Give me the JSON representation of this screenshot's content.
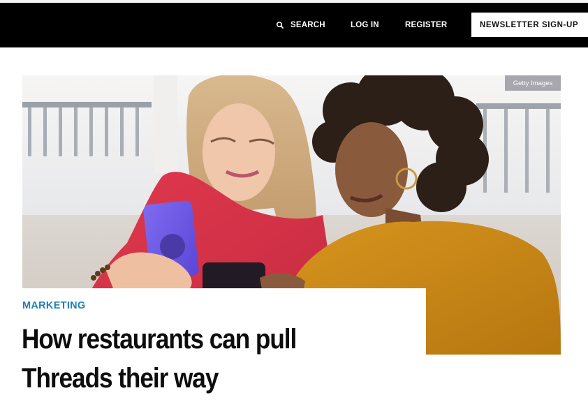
{
  "nav": {
    "search_label": "SEARCH",
    "login_label": "LOG IN",
    "register_label": "REGISTER",
    "newsletter_label": "NEWSLETTER SIGN-UP"
  },
  "hero": {
    "credit": "Getty Images"
  },
  "article": {
    "category": "MARKETING",
    "headline": "How restaurants can pull Threads their way"
  },
  "colors": {
    "nav_background": "#000000",
    "category_accent": "#1f7fb6",
    "credit_badge": "#a7a7ad"
  }
}
